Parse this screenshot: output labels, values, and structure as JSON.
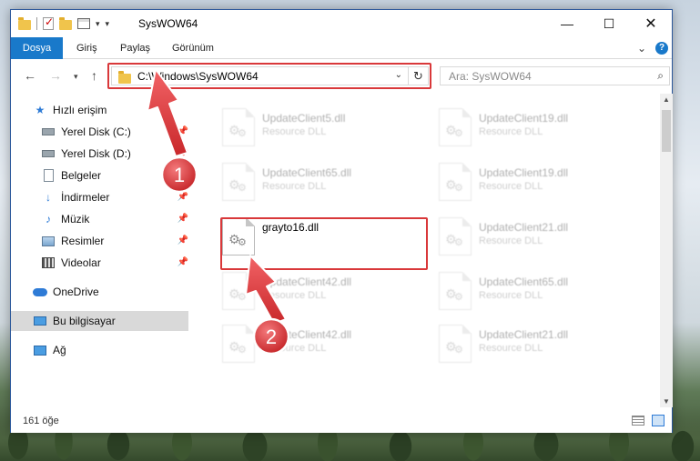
{
  "window": {
    "title": "SysWOW64",
    "min_glyph": "—",
    "max_glyph": "☐",
    "close_glyph": "✕"
  },
  "quick_access_toolbar": {
    "dropdown_glyph": "▾",
    "customize_glyph": "▾"
  },
  "ribbon": {
    "tabs": [
      "Dosya",
      "Giriş",
      "Paylaş",
      "Görünüm"
    ],
    "expand_glyph": "⌄",
    "help_glyph": "?"
  },
  "navigation": {
    "back_glyph": "←",
    "forward_glyph": "→",
    "recent_glyph": "▾",
    "up_glyph": "↑",
    "address": "C:\\Windows\\SysWOW64",
    "address_dropdown_glyph": "⌄",
    "refresh_glyph": "↻",
    "search_placeholder": "Ara: SysWOW64",
    "search_glyph": "⌕"
  },
  "sidebar": {
    "items": [
      {
        "label": "Hızlı erişim",
        "icon": "star-icon",
        "pinned": false
      },
      {
        "label": "Yerel Disk (C:)",
        "icon": "drive-icon",
        "pinned": true
      },
      {
        "label": "Yerel Disk (D:)",
        "icon": "drive-icon",
        "pinned": true
      },
      {
        "label": "Belgeler",
        "icon": "document-icon",
        "pinned": true
      },
      {
        "label": "İndirmeler",
        "icon": "download-icon",
        "pinned": true
      },
      {
        "label": "Müzik",
        "icon": "music-icon",
        "pinned": true
      },
      {
        "label": "Resimler",
        "icon": "pictures-icon",
        "pinned": true
      },
      {
        "label": "Videolar",
        "icon": "videos-icon",
        "pinned": true
      },
      {
        "label": "OneDrive",
        "icon": "cloud-icon",
        "pinned": false
      },
      {
        "label": "Bu bilgisayar",
        "icon": "computer-icon",
        "pinned": false,
        "selected": true
      },
      {
        "label": "Ağ",
        "icon": "network-icon",
        "pinned": false
      }
    ],
    "pin_glyph": "📌"
  },
  "files": {
    "left_column": [
      {
        "name": "UpdateClient5.dll",
        "type": "Resource DLL",
        "faded": true
      },
      {
        "name": "UpdateClient65.dll",
        "type": "Resource DLL",
        "faded": true
      },
      {
        "name": "grayto16.dll",
        "type": "",
        "faded": false,
        "highlighted": true
      },
      {
        "name": "UpdateClient42.dll",
        "type": "Resource DLL",
        "faded": true
      },
      {
        "name": "UpdateClient42.dll",
        "type": "Resource DLL",
        "faded": true
      }
    ],
    "right_column": [
      {
        "name": "UpdateClient19.dll",
        "type": "Resource DLL",
        "faded": true
      },
      {
        "name": "UpdateClient19.dll",
        "type": "Resource DLL",
        "faded": true
      },
      {
        "name": "UpdateClient21.dll",
        "type": "Resource DLL",
        "faded": true
      },
      {
        "name": "UpdateClient65.dll",
        "type": "Resource DLL",
        "faded": true
      },
      {
        "name": "UpdateClient21.dll",
        "type": "Resource DLL",
        "faded": true
      }
    ]
  },
  "status": {
    "item_count": "161 öğe"
  },
  "annotations": {
    "badge_1": "1",
    "badge_2": "2",
    "accent_color": "#d9383a"
  },
  "colors": {
    "file_tab": "#1979ca",
    "selected_sidebar": "#d9d9d9"
  }
}
